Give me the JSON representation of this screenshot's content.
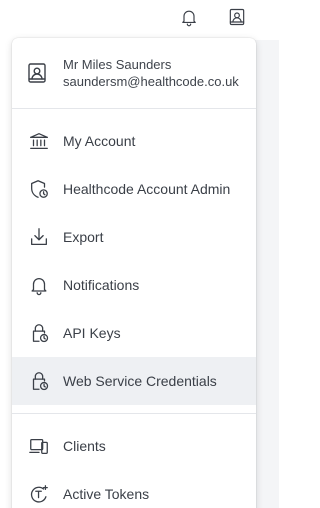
{
  "topbar": {
    "bell_icon": "bell-icon",
    "user_icon": "user-badge-icon"
  },
  "profile": {
    "icon": "user-badge-icon",
    "name": "Mr Miles Saunders",
    "email": "saundersm@healthcode.co.uk"
  },
  "menu": {
    "items": [
      {
        "label": "My Account",
        "icon": "bank-icon"
      },
      {
        "label": "Healthcode Account Admin",
        "icon": "shield-clock-icon"
      },
      {
        "label": "Export",
        "icon": "download-icon"
      },
      {
        "label": "Notifications",
        "icon": "bell-icon"
      },
      {
        "label": "API Keys",
        "icon": "lock-clock-icon"
      },
      {
        "label": "Web Service Credentials",
        "icon": "lock-clock-icon",
        "active": true
      }
    ],
    "secondary_items": [
      {
        "label": "Clients",
        "icon": "devices-icon"
      },
      {
        "label": "Active Tokens",
        "icon": "token-icon"
      }
    ]
  },
  "colors": {
    "text": "#3a3f47",
    "active_bg": "#eef0f3",
    "divider": "#e4e6ea",
    "backdrop": "#f4f5f7"
  }
}
